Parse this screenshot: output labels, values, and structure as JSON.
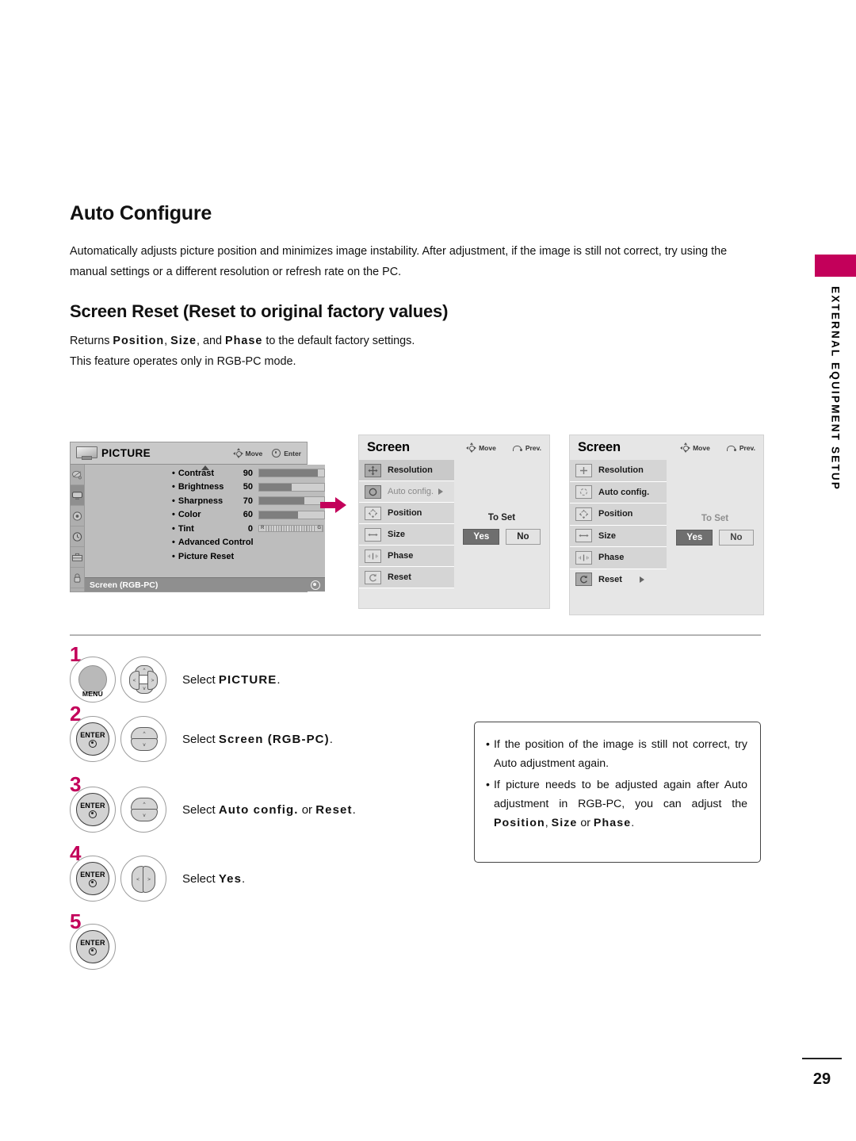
{
  "side_tab": {
    "label": "EXTERNAL EQUIPMENT SETUP",
    "accent": "#C3005A"
  },
  "sections": {
    "auto_configure": {
      "heading": "Auto Configure",
      "body": "Automatically adjusts picture position and minimizes image instability. After adjustment, if the image is still not correct, try using the manual settings or a different resolution or refresh rate on the PC."
    },
    "screen_reset": {
      "heading": "Screen Reset (Reset to original factory values)",
      "line1_pre": "Returns ",
      "line1_b1": "Position",
      "line1_sep1": ", ",
      "line1_b2": "Size",
      "line1_sep2": ", and ",
      "line1_b3": "Phase",
      "line1_post": " to the default factory settings.",
      "line2": "This feature operates only in RGB-PC mode."
    }
  },
  "picture_menu": {
    "title": "PICTURE",
    "hints": {
      "move": "Move",
      "enter": "Enter"
    },
    "rows": [
      {
        "label": "Contrast",
        "value": "90",
        "fill_pct": 90,
        "type": "bar"
      },
      {
        "label": "Brightness",
        "value": "50",
        "fill_pct": 50,
        "type": "bar"
      },
      {
        "label": "Sharpness",
        "value": "70",
        "fill_pct": 70,
        "type": "bar"
      },
      {
        "label": "Color",
        "value": "60",
        "fill_pct": 60,
        "type": "bar"
      },
      {
        "label": "Tint",
        "value": "0",
        "type": "tint",
        "tint_left": "R",
        "tint_right": "G"
      },
      {
        "label": "Advanced Control",
        "value": "",
        "type": "plain"
      },
      {
        "label": "Picture Reset",
        "value": "",
        "type": "plain"
      }
    ],
    "footer": "Screen (RGB-PC)"
  },
  "screen_menu_a": {
    "title": "Screen",
    "hints": {
      "move": "Move",
      "prev": "Prev."
    },
    "items": [
      {
        "label": "Resolution",
        "state": "active",
        "arrow": false
      },
      {
        "label": "Auto config.",
        "state": "dim",
        "arrow": true
      },
      {
        "label": "Position",
        "state": "normal",
        "arrow": false
      },
      {
        "label": "Size",
        "state": "normal",
        "arrow": false
      },
      {
        "label": "Phase",
        "state": "normal",
        "arrow": false
      },
      {
        "label": "Reset",
        "state": "normal",
        "arrow": false
      }
    ],
    "to_set": "To Set",
    "yes": "Yes",
    "no": "No"
  },
  "screen_menu_b": {
    "title": "Screen",
    "hints": {
      "move": "Move",
      "prev": "Prev."
    },
    "items": [
      {
        "label": "Resolution",
        "state": "normal",
        "arrow": false
      },
      {
        "label": "Auto config.",
        "state": "normal",
        "arrow": false
      },
      {
        "label": "Position",
        "state": "normal",
        "arrow": false
      },
      {
        "label": "Size",
        "state": "normal",
        "arrow": false
      },
      {
        "label": "Phase",
        "state": "normal",
        "arrow": false
      },
      {
        "label": "Reset",
        "state": "active",
        "arrow": true
      }
    ],
    "to_set": "To Set",
    "yes": "Yes",
    "no": "No"
  },
  "steps": [
    {
      "num": "1",
      "button": "MENU",
      "pad": "4way",
      "text_pre": "Select ",
      "text_b": "PICTURE",
      "text_post": "."
    },
    {
      "num": "2",
      "button": "ENTER",
      "pad": "vert",
      "text_pre": "Select ",
      "text_b": "Screen (RGB-PC)",
      "text_post": "."
    },
    {
      "num": "3",
      "button": "ENTER",
      "pad": "vert",
      "text_pre": "Select ",
      "text_b": "Auto config.",
      "text_mid": " or ",
      "text_b2": "Reset",
      "text_post": "."
    },
    {
      "num": "4",
      "button": "ENTER",
      "pad": "horiz",
      "text_pre": "Select ",
      "text_b": "Yes",
      "text_post": "."
    },
    {
      "num": "5",
      "button": "ENTER",
      "pad": "none",
      "text_pre": "",
      "text_b": "",
      "text_post": ""
    }
  ],
  "note": {
    "bullet1": "If the position of the image is still not correct, try Auto adjustment again.",
    "bullet2_a": "If picture needs to be adjusted again after Auto adjustment in RGB-PC, you can adjust the ",
    "bullet2_b1": "Position",
    "bullet2_sep": ", ",
    "bullet2_b2": "Size",
    "bullet2_mid": " or ",
    "bullet2_b3": "Phase",
    "bullet2_end": "."
  },
  "page_number": "29"
}
